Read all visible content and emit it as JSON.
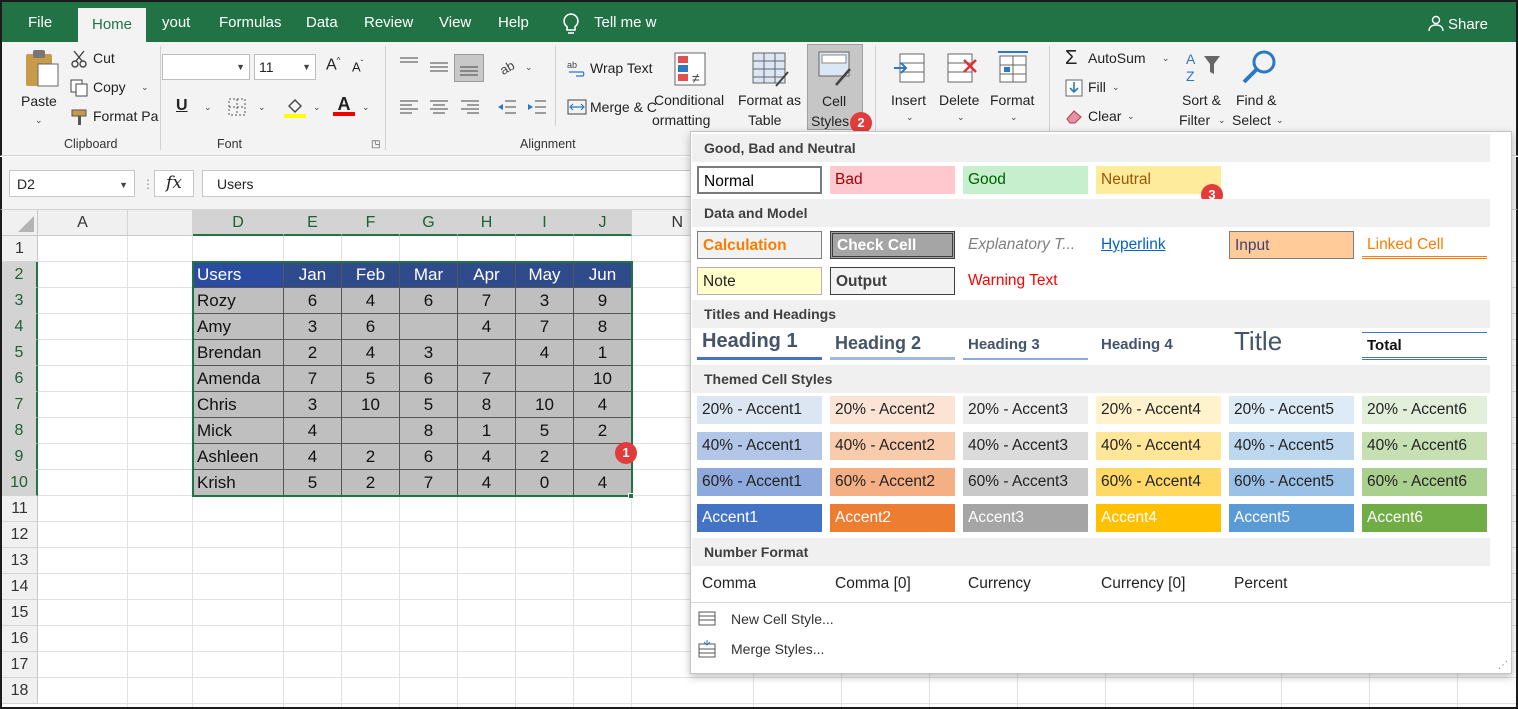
{
  "tabs": [
    "File",
    "Home",
    "yout",
    "Formulas",
    "Data",
    "Review",
    "View",
    "Help"
  ],
  "tell_me": "Tell me w",
  "share": "Share",
  "clipboard": {
    "paste": "Paste",
    "cut": "Cut",
    "copy": "Copy",
    "format_painter": "Format Pa",
    "group_label": "Clipboard"
  },
  "font": {
    "size": "11",
    "group_label": "Font"
  },
  "alignment": {
    "wrap_text": "Wrap Text",
    "merge": "Merge & C",
    "group_label": "Alignment"
  },
  "styles": {
    "conditional_line1": "Conditional",
    "conditional_line2": "ormatting",
    "format_as_table_line1": "Format as",
    "format_as_table_line2": "Table",
    "cell_styles_line1": "Cell",
    "cell_styles_line2": "Styles"
  },
  "cells": {
    "insert": "Insert",
    "delete": "Delete",
    "format": "Format"
  },
  "editing": {
    "autosum": "AutoSum",
    "fill": "Fill",
    "clear": "Clear",
    "sort_line1": "Sort &",
    "sort_line2": "Filter",
    "find_line1": "Find &",
    "find_line2": "Select"
  },
  "name_box": "D2",
  "formula_value": "Users",
  "columns": [
    "A",
    "D",
    "E",
    "F",
    "G",
    "H",
    "I",
    "J",
    "N"
  ],
  "rows": [
    "1",
    "2",
    "3",
    "4",
    "5",
    "6",
    "7",
    "8",
    "9",
    "10",
    "11",
    "12",
    "13",
    "14",
    "15",
    "16",
    "17",
    "18"
  ],
  "table": {
    "header": [
      "Users",
      "Jan",
      "Feb",
      "Mar",
      "Apr",
      "May",
      "Jun"
    ],
    "rows": [
      [
        "Rozy",
        "6",
        "4",
        "6",
        "7",
        "3",
        "9"
      ],
      [
        "Amy",
        "3",
        "6",
        "",
        "4",
        "7",
        "8"
      ],
      [
        "Brendan",
        "2",
        "4",
        "3",
        "",
        "4",
        "1"
      ],
      [
        "Amenda",
        "7",
        "5",
        "6",
        "7",
        "",
        "10"
      ],
      [
        "Chris",
        "3",
        "10",
        "5",
        "8",
        "10",
        "4"
      ],
      [
        "Mick",
        "4",
        "",
        "8",
        "1",
        "5",
        "2"
      ],
      [
        "Ashleen",
        "4",
        "2",
        "6",
        "4",
        "2",
        ""
      ],
      [
        "Krish",
        "5",
        "2",
        "7",
        "4",
        "0",
        "4"
      ]
    ]
  },
  "badges": [
    "1",
    "2",
    "3"
  ],
  "gallery": {
    "sections": [
      "Good, Bad and Neutral",
      "Data and Model",
      "Titles and Headings",
      "Themed Cell Styles",
      "Number Format"
    ],
    "good_bad": [
      {
        "label": "Normal",
        "bg": "#ffffff",
        "fg": "#000000"
      },
      {
        "label": "Bad",
        "bg": "#ffc7ce",
        "fg": "#9c0006"
      },
      {
        "label": "Good",
        "bg": "#c6efce",
        "fg": "#006100"
      },
      {
        "label": "Neutral",
        "bg": "#ffeb9c",
        "fg": "#9c5700"
      }
    ],
    "data_model_row1": [
      "Calculation",
      "Check Cell",
      "Explanatory T...",
      "Hyperlink",
      "Input",
      "Linked Cell"
    ],
    "data_model_row2": [
      "Note",
      "Output",
      "Warning Text"
    ],
    "titles": [
      "Heading 1",
      "Heading 2",
      "Heading 3",
      "Heading 4",
      "Title",
      "Total"
    ],
    "themed_20": [
      "20% - Accent1",
      "20% - Accent2",
      "20% - Accent3",
      "20% - Accent4",
      "20% - Accent5",
      "20% - Accent6"
    ],
    "themed_40": [
      "40% - Accent1",
      "40% - Accent2",
      "40% - Accent3",
      "40% - Accent4",
      "40% - Accent5",
      "40% - Accent6"
    ],
    "themed_60": [
      "60% - Accent1",
      "60% - Accent2",
      "60% - Accent3",
      "60% - Accent4",
      "60% - Accent5",
      "60% - Accent6"
    ],
    "themed_100": [
      "Accent1",
      "Accent2",
      "Accent3",
      "Accent4",
      "Accent5",
      "Accent6"
    ],
    "color_20": [
      "#dce6f2",
      "#fbe4d6",
      "#ededed",
      "#fff2cc",
      "#ddebf7",
      "#e2efda"
    ],
    "color_40": [
      "#b4c6e7",
      "#f8cbad",
      "#dbdbdb",
      "#ffe699",
      "#bdd7ee",
      "#c6e0b4"
    ],
    "color_60": [
      "#8ea9db",
      "#f4b084",
      "#c9c9c9",
      "#ffd966",
      "#9bc2e6",
      "#a9d08e"
    ],
    "color_100": [
      "#4472c4",
      "#ed7d31",
      "#a5a5a5",
      "#ffc000",
      "#5b9bd5",
      "#70ad47"
    ],
    "number_formats": [
      "Comma",
      "Comma [0]",
      "Currency",
      "Currency [0]",
      "Percent"
    ],
    "new_style": "New Cell Style...",
    "merge_styles": "Merge Styles..."
  },
  "colors": {
    "excel_green": "#217346",
    "header_blue": "#2f4b8c",
    "badge_red": "#e23b3b"
  }
}
